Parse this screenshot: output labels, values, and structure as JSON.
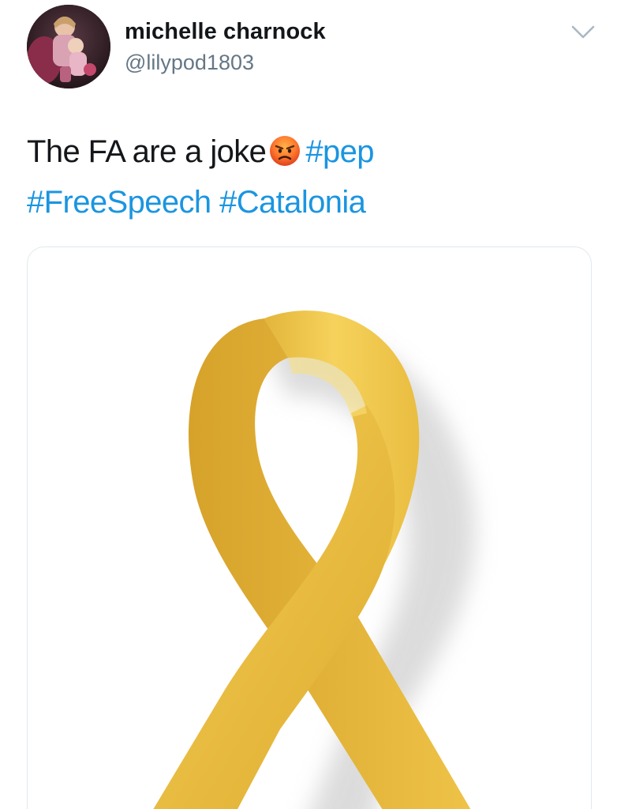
{
  "tweet": {
    "author": {
      "display_name": "michelle charnock",
      "handle": "@lilypod1803"
    },
    "text_plain": "The FA are a joke",
    "emoji": "angry-face",
    "hashtags": [
      "#pep",
      "#FreeSpeech",
      "#Catalonia"
    ],
    "media": {
      "description_icon": "yellow-ribbon",
      "ribbon_color": "#f2c94c"
    }
  },
  "colors": {
    "link": "#1b95e0",
    "text": "#14171a",
    "secondary": "#657786",
    "card_border": "#e1e8ed"
  }
}
